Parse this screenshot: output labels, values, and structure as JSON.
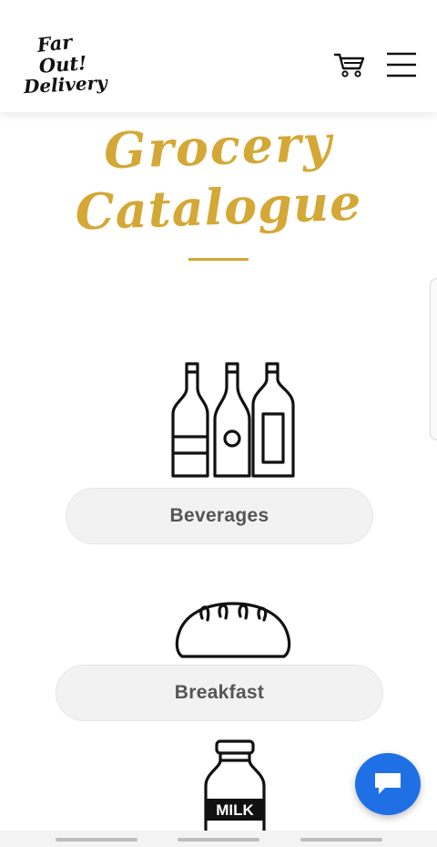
{
  "header": {
    "logo_lines": [
      "Far",
      "Out!",
      "Delivery"
    ],
    "cart_icon": "cart-icon",
    "menu_icon": "hamburger-menu-icon"
  },
  "page": {
    "title_line1": "Grocery",
    "title_line2": "Catalogue",
    "accent_color": "#d4a836"
  },
  "categories": [
    {
      "label": "Beverages",
      "icon": "bottles-icon"
    },
    {
      "label": "Breakfast",
      "icon": "bread-icon"
    },
    {
      "label": "",
      "icon": "milk-bottle-icon",
      "icon_text": "MILK"
    }
  ],
  "chat": {
    "icon": "chat-bubble-icon",
    "color": "#1f6fe5"
  }
}
